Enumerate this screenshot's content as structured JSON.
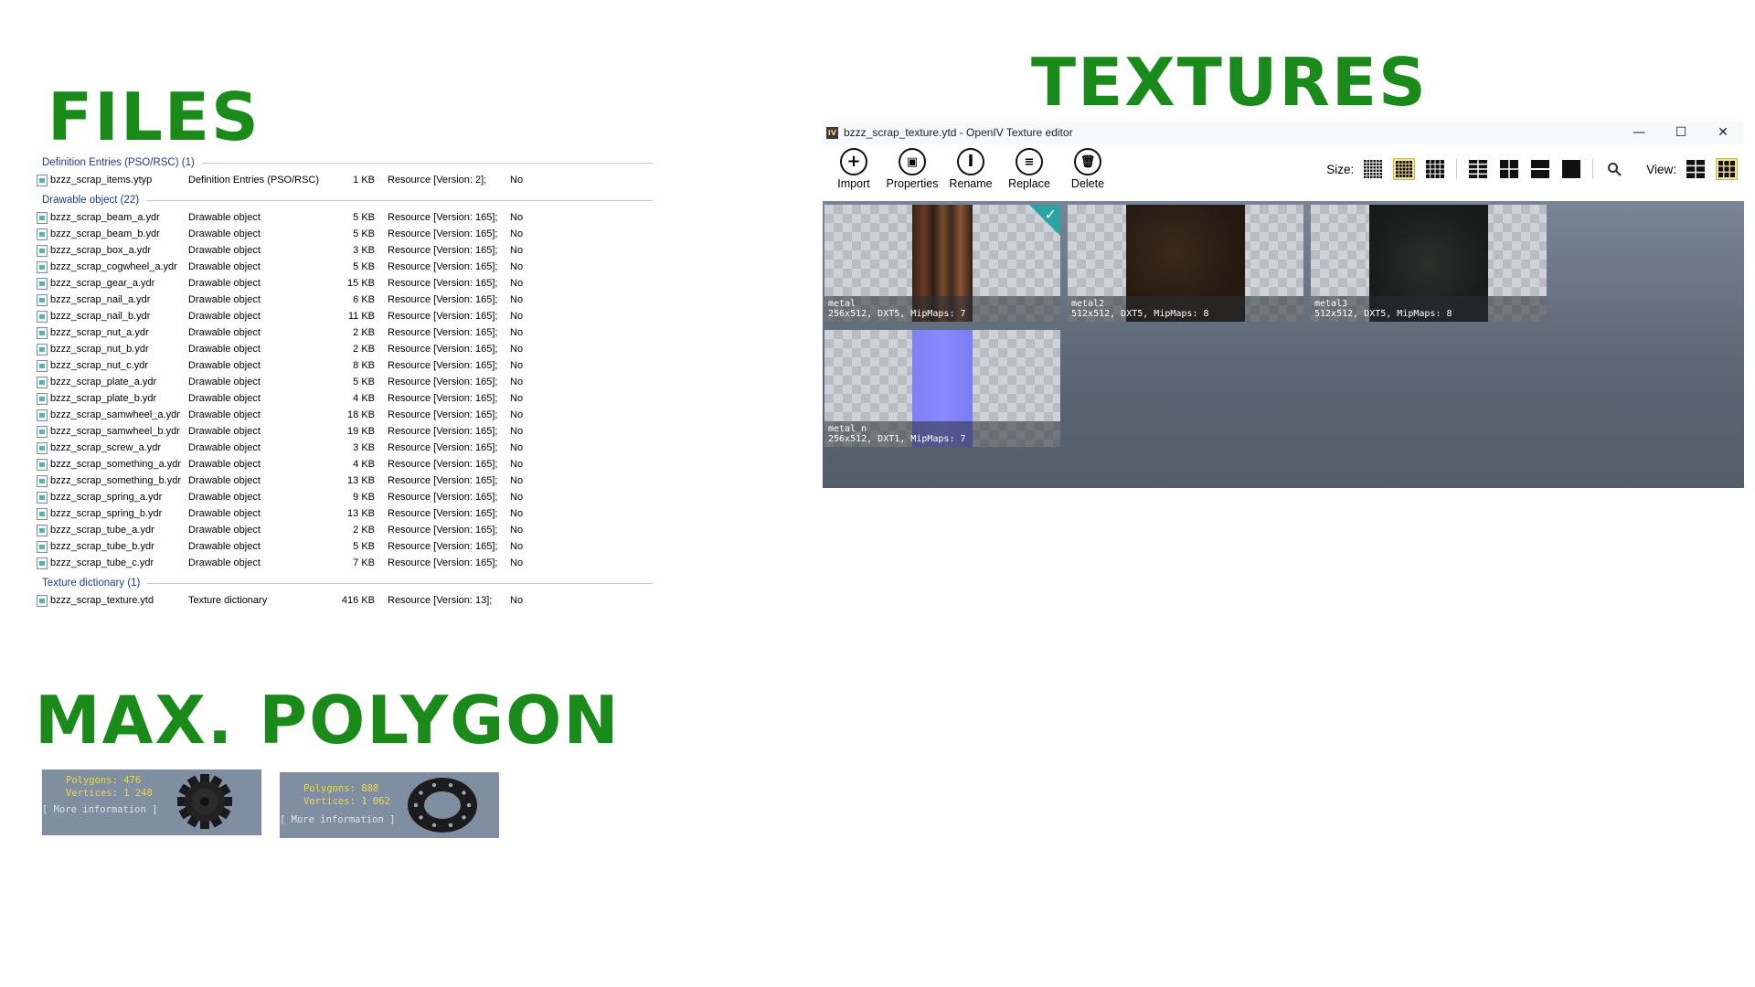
{
  "headings": {
    "files": "FILES",
    "textures": "TEXTURES",
    "max_polygon": "MAX. POLYGON"
  },
  "files_list": {
    "groups": [
      {
        "header": "Definition Entries (PSO/RSC) (1)",
        "rows": [
          {
            "name": "bzzz_scrap_items.ytyp",
            "type": "Definition Entries (PSO/RSC)",
            "size": "1 KB",
            "resource": "Resource [Version: 2];",
            "encrypted": "No"
          }
        ]
      },
      {
        "header": "Drawable object (22)",
        "rows": [
          {
            "name": "bzzz_scrap_beam_a.ydr",
            "type": "Drawable object",
            "size": "5 KB",
            "resource": "Resource [Version: 165];",
            "encrypted": "No"
          },
          {
            "name": "bzzz_scrap_beam_b.ydr",
            "type": "Drawable object",
            "size": "5 KB",
            "resource": "Resource [Version: 165];",
            "encrypted": "No"
          },
          {
            "name": "bzzz_scrap_box_a.ydr",
            "type": "Drawable object",
            "size": "3 KB",
            "resource": "Resource [Version: 165];",
            "encrypted": "No"
          },
          {
            "name": "bzzz_scrap_cogwheel_a.ydr",
            "type": "Drawable object",
            "size": "5 KB",
            "resource": "Resource [Version: 165];",
            "encrypted": "No"
          },
          {
            "name": "bzzz_scrap_gear_a.ydr",
            "type": "Drawable object",
            "size": "15 KB",
            "resource": "Resource [Version: 165];",
            "encrypted": "No"
          },
          {
            "name": "bzzz_scrap_nail_a.ydr",
            "type": "Drawable object",
            "size": "6 KB",
            "resource": "Resource [Version: 165];",
            "encrypted": "No"
          },
          {
            "name": "bzzz_scrap_nail_b.ydr",
            "type": "Drawable object",
            "size": "11 KB",
            "resource": "Resource [Version: 165];",
            "encrypted": "No"
          },
          {
            "name": "bzzz_scrap_nut_a.ydr",
            "type": "Drawable object",
            "size": "2 KB",
            "resource": "Resource [Version: 165];",
            "encrypted": "No"
          },
          {
            "name": "bzzz_scrap_nut_b.ydr",
            "type": "Drawable object",
            "size": "2 KB",
            "resource": "Resource [Version: 165];",
            "encrypted": "No"
          },
          {
            "name": "bzzz_scrap_nut_c.ydr",
            "type": "Drawable object",
            "size": "8 KB",
            "resource": "Resource [Version: 165];",
            "encrypted": "No"
          },
          {
            "name": "bzzz_scrap_plate_a.ydr",
            "type": "Drawable object",
            "size": "5 KB",
            "resource": "Resource [Version: 165];",
            "encrypted": "No"
          },
          {
            "name": "bzzz_scrap_plate_b.ydr",
            "type": "Drawable object",
            "size": "4 KB",
            "resource": "Resource [Version: 165];",
            "encrypted": "No"
          },
          {
            "name": "bzzz_scrap_samwheel_a.ydr",
            "type": "Drawable object",
            "size": "18 KB",
            "resource": "Resource [Version: 165];",
            "encrypted": "No"
          },
          {
            "name": "bzzz_scrap_samwheel_b.ydr",
            "type": "Drawable object",
            "size": "19 KB",
            "resource": "Resource [Version: 165];",
            "encrypted": "No"
          },
          {
            "name": "bzzz_scrap_screw_a.ydr",
            "type": "Drawable object",
            "size": "3 KB",
            "resource": "Resource [Version: 165];",
            "encrypted": "No"
          },
          {
            "name": "bzzz_scrap_something_a.ydr",
            "type": "Drawable object",
            "size": "4 KB",
            "resource": "Resource [Version: 165];",
            "encrypted": "No"
          },
          {
            "name": "bzzz_scrap_something_b.ydr",
            "type": "Drawable object",
            "size": "13 KB",
            "resource": "Resource [Version: 165];",
            "encrypted": "No"
          },
          {
            "name": "bzzz_scrap_spring_a.ydr",
            "type": "Drawable object",
            "size": "9 KB",
            "resource": "Resource [Version: 165];",
            "encrypted": "No"
          },
          {
            "name": "bzzz_scrap_spring_b.ydr",
            "type": "Drawable object",
            "size": "13 KB",
            "resource": "Resource [Version: 165];",
            "encrypted": "No"
          },
          {
            "name": "bzzz_scrap_tube_a.ydr",
            "type": "Drawable object",
            "size": "2 KB",
            "resource": "Resource [Version: 165];",
            "encrypted": "No"
          },
          {
            "name": "bzzz_scrap_tube_b.ydr",
            "type": "Drawable object",
            "size": "5 KB",
            "resource": "Resource [Version: 165];",
            "encrypted": "No"
          },
          {
            "name": "bzzz_scrap_tube_c.ydr",
            "type": "Drawable object",
            "size": "7 KB",
            "resource": "Resource [Version: 165];",
            "encrypted": "No"
          }
        ]
      },
      {
        "header": "Texture dictionary (1)",
        "rows": [
          {
            "name": "bzzz_scrap_texture.ytd",
            "type": "Texture dictionary",
            "size": "416 KB",
            "resource": "Resource [Version: 13];",
            "encrypted": "No"
          }
        ]
      }
    ]
  },
  "texture_editor": {
    "window_title": "bzzz_scrap_texture.ytd - OpenIV Texture editor",
    "app_icon": "IV",
    "window_controls": {
      "minimize": "—",
      "maximize": "☐",
      "close": "✕"
    },
    "toolbar": [
      {
        "id": "import",
        "label": "Import",
        "icon": "plus-icon",
        "glyph": "+"
      },
      {
        "id": "properties",
        "label": "Properties",
        "icon": "properties-icon",
        "glyph": "▣"
      },
      {
        "id": "rename",
        "label": "Rename",
        "icon": "rename-icon",
        "glyph": "I"
      },
      {
        "id": "replace",
        "label": "Replace",
        "icon": "replace-icon",
        "glyph": "≡"
      },
      {
        "id": "delete",
        "label": "Delete",
        "icon": "trash-icon",
        "glyph": "🗑"
      }
    ],
    "size_label": "Size:",
    "view_label": "View:",
    "selected_size_index": 1,
    "selected_view_index": 1,
    "colors": {
      "accent": "#2ba3a0",
      "selected_button_bg": "#f2e39a",
      "heading_green": "#1a8a1a"
    },
    "textures": [
      {
        "name": "metal",
        "info": "256x512, DXT5, MipMaps: 7",
        "selected": true,
        "swatch": "rust-metal",
        "col": 0,
        "row": 0
      },
      {
        "name": "metal2",
        "info": "512x512, DXT5, MipMaps: 8",
        "selected": false,
        "swatch": "dark-brown-metal",
        "col": 1,
        "row": 0
      },
      {
        "name": "metal3",
        "info": "512x512, DXT5, MipMaps: 8",
        "selected": false,
        "swatch": "dark-teal-metal",
        "col": 2,
        "row": 0
      },
      {
        "name": "metal_n",
        "info": "256x512, DXT1, MipMaps: 7",
        "selected": false,
        "swatch": "normal-map-blue",
        "col": 0,
        "row": 1
      }
    ]
  },
  "polygons": [
    {
      "polygons_text": "Polygons: 476",
      "vertices_text": "Vertices: 1 248",
      "more": "[ More information ]",
      "mesh": "gear-model"
    },
    {
      "polygons_text": "Polygons: 888",
      "vertices_text": "Vertices: 1 062",
      "more": "[ More information ]",
      "mesh": "flange-ring-model"
    }
  ]
}
